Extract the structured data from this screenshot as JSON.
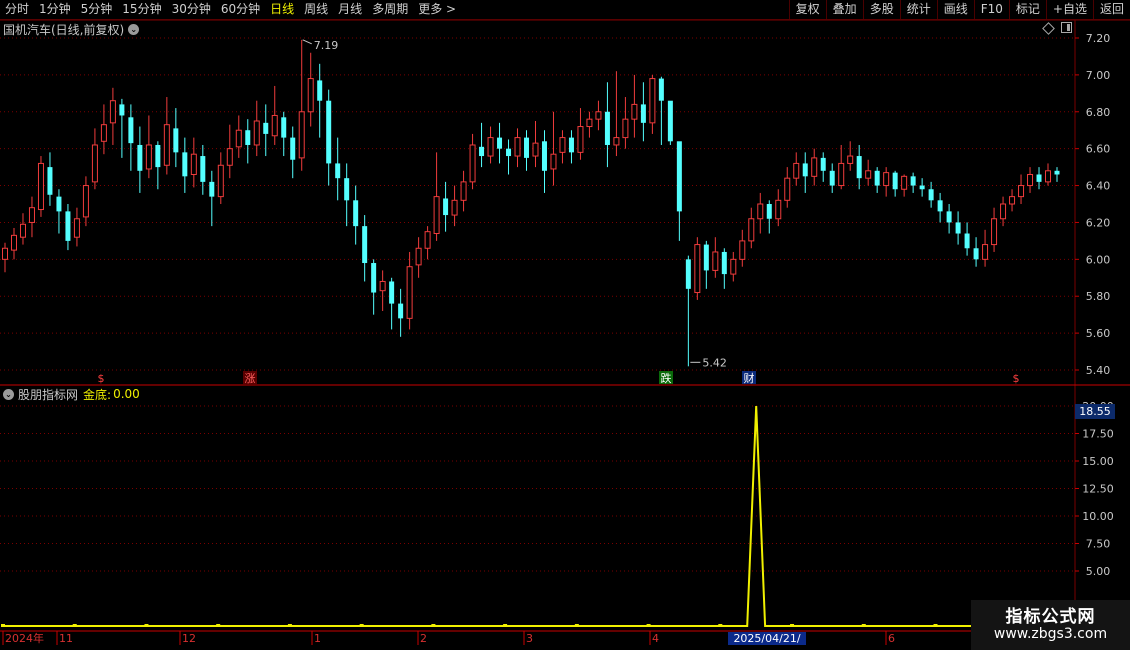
{
  "toolbar": {
    "periods": [
      "分时",
      "1分钟",
      "5分钟",
      "15分钟",
      "30分钟",
      "60分钟",
      "日线",
      "周线",
      "月线",
      "多周期",
      "更多 >"
    ],
    "active_period": "日线",
    "tools": [
      "复权",
      "叠加",
      "多股",
      "统计",
      "画线",
      "F10",
      "标记",
      "+自选",
      "返回"
    ]
  },
  "main_panel": {
    "title": "国机汽车(日线,前复权)",
    "y_ticks": [
      "7.20",
      "7.00",
      "6.80",
      "6.60",
      "6.40",
      "6.20",
      "6.00",
      "5.80",
      "5.60",
      "5.40"
    ],
    "high_label": "7.19",
    "low_label": "5.42",
    "markers": [
      "$",
      "涨",
      "跌",
      "财",
      "$"
    ]
  },
  "indicator_panel": {
    "name": "股朋指标网",
    "label": "金底:",
    "value": "0.00",
    "y_ticks": [
      "20.00",
      "17.50",
      "15.00",
      "12.50",
      "10.00",
      "7.50",
      "5.00"
    ],
    "current_value_box": "18.55"
  },
  "date_axis": {
    "labels": [
      "2024年",
      "11",
      "12",
      "1",
      "2",
      "3",
      "4",
      "2025/04/21/一",
      "6"
    ]
  },
  "watermark": {
    "title": "指标公式网",
    "url": "www.zbgs3.com"
  },
  "colors": {
    "up": "#f03c3c",
    "down": "#54ffff",
    "grid": "#7a0000",
    "indicator": "#f0f000",
    "active_period": "#f0f000"
  },
  "chart_data": [
    {
      "type": "candlestick",
      "title": "国机汽车(日线,前复权)",
      "ylim": [
        5.4,
        7.2
      ],
      "annotations": [
        {
          "text": "7.19",
          "y": 7.19
        },
        {
          "text": "5.42",
          "y": 5.42
        }
      ],
      "values": [
        [
          6.0,
          6.06,
          5.93,
          6.09
        ],
        [
          6.05,
          6.13,
          6.0,
          6.17
        ],
        [
          6.12,
          6.19,
          6.08,
          6.25
        ],
        [
          6.2,
          6.28,
          6.12,
          6.34
        ],
        [
          6.27,
          6.52,
          6.23,
          6.56
        ],
        [
          6.5,
          6.35,
          6.29,
          6.58
        ],
        [
          6.34,
          6.26,
          6.14,
          6.38
        ],
        [
          6.26,
          6.1,
          6.05,
          6.3
        ],
        [
          6.12,
          6.22,
          6.07,
          6.28
        ],
        [
          6.23,
          6.4,
          6.18,
          6.45
        ],
        [
          6.42,
          6.62,
          6.38,
          6.71
        ],
        [
          6.64,
          6.73,
          6.57,
          6.84
        ],
        [
          6.74,
          6.86,
          6.62,
          6.93
        ],
        [
          6.84,
          6.78,
          6.55,
          6.87
        ],
        [
          6.77,
          6.63,
          6.48,
          6.84
        ],
        [
          6.62,
          6.48,
          6.36,
          6.72
        ],
        [
          6.49,
          6.62,
          6.44,
          6.78
        ],
        [
          6.62,
          6.5,
          6.38,
          6.64
        ],
        [
          6.51,
          6.73,
          6.46,
          6.88
        ],
        [
          6.71,
          6.58,
          6.5,
          6.82
        ],
        [
          6.58,
          6.45,
          6.36,
          6.66
        ],
        [
          6.46,
          6.57,
          6.39,
          6.66
        ],
        [
          6.56,
          6.42,
          6.35,
          6.62
        ],
        [
          6.42,
          6.34,
          6.18,
          6.48
        ],
        [
          6.34,
          6.51,
          6.3,
          6.58
        ],
        [
          6.51,
          6.6,
          6.44,
          6.73
        ],
        [
          6.61,
          6.7,
          6.55,
          6.78
        ],
        [
          6.7,
          6.62,
          6.52,
          6.76
        ],
        [
          6.62,
          6.75,
          6.56,
          6.86
        ],
        [
          6.74,
          6.68,
          6.56,
          6.84
        ],
        [
          6.67,
          6.78,
          6.62,
          6.94
        ],
        [
          6.77,
          6.66,
          6.56,
          6.8
        ],
        [
          6.66,
          6.54,
          6.44,
          6.72
        ],
        [
          6.55,
          6.8,
          6.48,
          7.19
        ],
        [
          6.8,
          6.98,
          6.72,
          7.12
        ],
        [
          6.97,
          6.86,
          6.66,
          7.06
        ],
        [
          6.86,
          6.52,
          6.4,
          6.92
        ],
        [
          6.52,
          6.44,
          6.32,
          6.66
        ],
        [
          6.44,
          6.32,
          6.18,
          6.52
        ],
        [
          6.32,
          6.18,
          6.08,
          6.4
        ],
        [
          6.18,
          5.98,
          5.88,
          6.24
        ],
        [
          5.98,
          5.82,
          5.7,
          6.0
        ],
        [
          5.83,
          5.88,
          5.72,
          5.94
        ],
        [
          5.88,
          5.76,
          5.62,
          5.9
        ],
        [
          5.76,
          5.68,
          5.58,
          5.84
        ],
        [
          5.68,
          5.96,
          5.62,
          6.04
        ],
        [
          5.97,
          6.06,
          5.9,
          6.12
        ],
        [
          6.06,
          6.15,
          6.0,
          6.18
        ],
        [
          6.14,
          6.34,
          6.1,
          6.58
        ],
        [
          6.33,
          6.24,
          6.15,
          6.42
        ],
        [
          6.24,
          6.32,
          6.18,
          6.4
        ],
        [
          6.32,
          6.42,
          6.26,
          6.48
        ],
        [
          6.42,
          6.62,
          6.38,
          6.68
        ],
        [
          6.61,
          6.56,
          6.5,
          6.74
        ],
        [
          6.56,
          6.66,
          6.52,
          6.72
        ],
        [
          6.66,
          6.6,
          6.52,
          6.74
        ],
        [
          6.6,
          6.56,
          6.46,
          6.65
        ],
        [
          6.56,
          6.66,
          6.5,
          6.71
        ],
        [
          6.66,
          6.55,
          6.48,
          6.7
        ],
        [
          6.56,
          6.63,
          6.5,
          6.75
        ],
        [
          6.64,
          6.48,
          6.36,
          6.7
        ],
        [
          6.49,
          6.57,
          6.4,
          6.8
        ],
        [
          6.58,
          6.66,
          6.52,
          6.7
        ],
        [
          6.66,
          6.58,
          6.52,
          6.7
        ],
        [
          6.58,
          6.72,
          6.54,
          6.82
        ],
        [
          6.72,
          6.76,
          6.66,
          6.8
        ],
        [
          6.76,
          6.8,
          6.7,
          6.86
        ],
        [
          6.8,
          6.62,
          6.5,
          6.96
        ],
        [
          6.62,
          6.66,
          6.56,
          7.02
        ],
        [
          6.66,
          6.76,
          6.6,
          6.88
        ],
        [
          6.76,
          6.84,
          6.66,
          7.0
        ],
        [
          6.84,
          6.74,
          6.64,
          6.96
        ],
        [
          6.74,
          6.98,
          6.68,
          7.0
        ],
        [
          6.98,
          6.86,
          6.62,
          6.99
        ],
        [
          6.86,
          6.64,
          6.62,
          6.84
        ],
        [
          6.64,
          6.26,
          6.1,
          6.32
        ],
        [
          6.0,
          5.84,
          5.42,
          6.02
        ],
        [
          5.82,
          6.08,
          5.78,
          6.12
        ],
        [
          6.08,
          5.94,
          5.84,
          6.1
        ],
        [
          5.94,
          6.04,
          5.9,
          6.12
        ],
        [
          6.04,
          5.92,
          5.84,
          6.06
        ],
        [
          5.92,
          6.0,
          5.88,
          6.04
        ],
        [
          6.0,
          6.1,
          5.96,
          6.16
        ],
        [
          6.1,
          6.22,
          6.06,
          6.28
        ],
        [
          6.22,
          6.3,
          6.14,
          6.36
        ],
        [
          6.3,
          6.22,
          6.14,
          6.32
        ],
        [
          6.22,
          6.32,
          6.18,
          6.38
        ],
        [
          6.32,
          6.44,
          6.28,
          6.5
        ],
        [
          6.44,
          6.52,
          6.4,
          6.58
        ],
        [
          6.52,
          6.45,
          6.36,
          6.58
        ],
        [
          6.45,
          6.55,
          6.4,
          6.6
        ],
        [
          6.55,
          6.48,
          6.42,
          6.58
        ],
        [
          6.48,
          6.4,
          6.36,
          6.52
        ],
        [
          6.4,
          6.52,
          6.38,
          6.62
        ],
        [
          6.52,
          6.56,
          6.48,
          6.64
        ],
        [
          6.56,
          6.44,
          6.38,
          6.62
        ],
        [
          6.44,
          6.48,
          6.4,
          6.54
        ],
        [
          6.48,
          6.4,
          6.36,
          6.5
        ],
        [
          6.4,
          6.47,
          6.34,
          6.5
        ],
        [
          6.47,
          6.38,
          6.34,
          6.48
        ],
        [
          6.38,
          6.45,
          6.34,
          6.46
        ],
        [
          6.45,
          6.4,
          6.36,
          6.47
        ],
        [
          6.4,
          6.38,
          6.34,
          6.44
        ],
        [
          6.38,
          6.32,
          6.28,
          6.42
        ],
        [
          6.32,
          6.26,
          6.2,
          6.36
        ],
        [
          6.26,
          6.2,
          6.14,
          6.3
        ],
        [
          6.2,
          6.14,
          6.08,
          6.26
        ],
        [
          6.14,
          6.06,
          6.02,
          6.2
        ],
        [
          6.06,
          6.0,
          5.96,
          6.12
        ],
        [
          6.0,
          6.08,
          5.96,
          6.16
        ],
        [
          6.08,
          6.22,
          6.04,
          6.28
        ],
        [
          6.22,
          6.3,
          6.18,
          6.34
        ],
        [
          6.3,
          6.34,
          6.26,
          6.38
        ],
        [
          6.34,
          6.4,
          6.3,
          6.46
        ],
        [
          6.4,
          6.46,
          6.36,
          6.5
        ],
        [
          6.46,
          6.42,
          6.38,
          6.5
        ],
        [
          6.42,
          6.48,
          6.4,
          6.52
        ],
        [
          6.48,
          6.46,
          6.42,
          6.5
        ]
      ]
    },
    {
      "type": "line",
      "name": "金底",
      "ylim": [
        0,
        20
      ],
      "spike_indices": [
        84
      ],
      "spike_value": 20.0,
      "baseline_value": 0.0,
      "n_points": 120
    }
  ]
}
